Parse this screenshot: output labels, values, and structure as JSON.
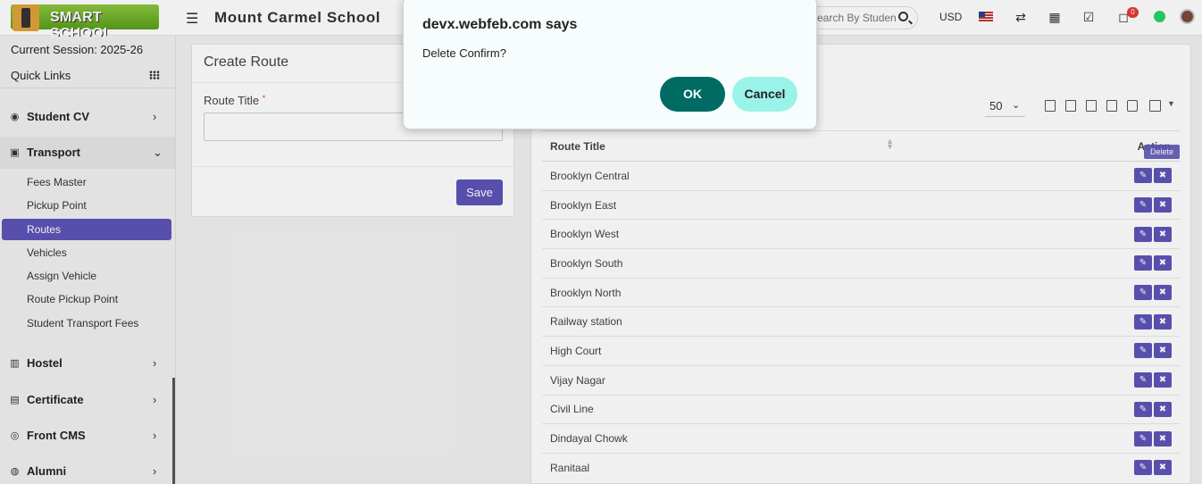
{
  "header": {
    "logo_text": "SMART SCHOOL",
    "school_name": "Mount Carmel School",
    "search_placeholder": "Search By Student Name, Roll No...",
    "currency": "USD",
    "notification_count": "0"
  },
  "sidebar": {
    "session": "Current Session: 2025-26",
    "quick_links": "Quick Links",
    "menu": {
      "student_cv": "Student CV",
      "transport": "Transport",
      "hostel": "Hostel",
      "certificate": "Certificate",
      "front_cms": "Front CMS",
      "alumni": "Alumni"
    },
    "transport_sub": [
      "Fees Master",
      "Pickup Point",
      "Routes",
      "Vehicles",
      "Assign Vehicle",
      "Route Pickup Point",
      "Student Transport Fees"
    ]
  },
  "create_route": {
    "title": "Create Route",
    "field_label": "Route Title",
    "required_mark": "*",
    "save_label": "Save"
  },
  "route_list": {
    "page_size": "50",
    "columns": {
      "title": "Route Title",
      "action": "Action"
    },
    "rows": [
      "Brooklyn Central",
      "Brooklyn East",
      "Brooklyn West",
      "Brooklyn South",
      "Brooklyn North",
      "Railway station",
      "High Court",
      "Vijay Nagar",
      "Civil Line",
      "Dindayal Chowk",
      "Ranitaal"
    ],
    "tooltip": "Delete"
  },
  "dialog": {
    "title": "devx.webfeb.com says",
    "message": "Delete Confirm?",
    "ok_label": "OK",
    "cancel_label": "Cancel"
  },
  "colors": {
    "accent": "#5e54b8",
    "ok_button": "#006b63",
    "cancel_button": "#99f3e8"
  }
}
